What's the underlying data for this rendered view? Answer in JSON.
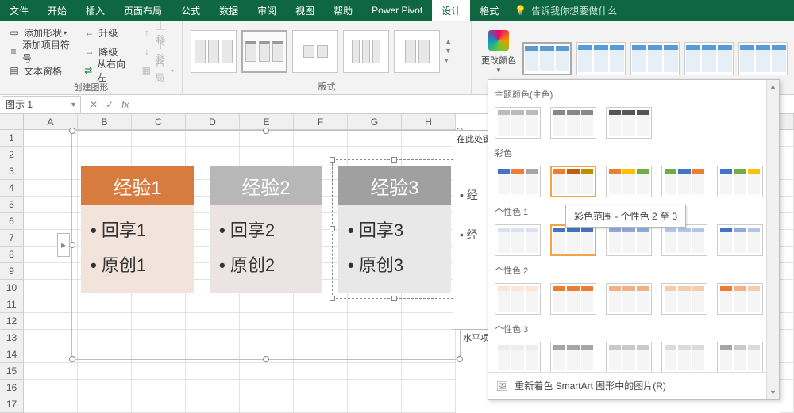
{
  "menu": {
    "items": [
      "文件",
      "开始",
      "插入",
      "页面布局",
      "公式",
      "数据",
      "审阅",
      "视图",
      "帮助",
      "Power Pivot",
      "设计",
      "格式"
    ],
    "active_index": 10,
    "tell_me": "告诉我你想要做什么"
  },
  "ribbon": {
    "group_create": {
      "label": "创建图形",
      "add_shape": "添加形状",
      "add_bullet": "添加项目符号",
      "text_pane": "文本窗格",
      "promote": "升级",
      "demote": "降级",
      "rtl": "从右向左",
      "move_up": "上移",
      "move_down": "下移",
      "layout_btn": "布局"
    },
    "group_layout": {
      "label": "版式"
    },
    "change_colors": "更改颜色"
  },
  "name_box": {
    "value": "图示 1"
  },
  "columns": [
    "A",
    "B",
    "C",
    "D",
    "E",
    "F",
    "G",
    "H"
  ],
  "rows": [
    1,
    2,
    3,
    4,
    5,
    6,
    7,
    8,
    9,
    10,
    11,
    12,
    13,
    14,
    15,
    16,
    17
  ],
  "smartart": {
    "cards": [
      {
        "title": "经验1",
        "items": [
          "回享1",
          "原创1"
        ]
      },
      {
        "title": "经验2",
        "items": [
          "回享2",
          "原创2"
        ]
      },
      {
        "title": "经验3",
        "items": [
          "回享3",
          "原创3"
        ]
      }
    ]
  },
  "text_pane": {
    "title": "在此处键入",
    "items": [
      "经",
      "经"
    ],
    "footer": "水平项目"
  },
  "color_dropdown": {
    "sections": {
      "theme": "主题颜色(主色)",
      "colorful": "彩色",
      "accent1": "个性色 1",
      "accent2": "个性色 2",
      "accent3": "个性色 3"
    },
    "tooltip": "彩色范围 - 个性色 2 至 3",
    "footer": "重新着色 SmartArt 图形中的图片(R)"
  },
  "style_accents": [
    "#5a9bd5",
    "#5a9bd5",
    "#5a9bd5",
    "#5a9bd5",
    "#5a9bd5"
  ],
  "colorful_row": [
    [
      "#4472c4",
      "#ed7d31",
      "#a5a5a5"
    ],
    [
      "#ed7d31",
      "#c55a11",
      "#bf8f00"
    ],
    [
      "#ed7d31",
      "#ffc000",
      "#70ad47"
    ],
    [
      "#70ad47",
      "#4472c4",
      "#ed7d31"
    ],
    [
      "#4472c4",
      "#70ad47",
      "#ffc000"
    ]
  ],
  "accent1_row": [
    [
      "#d9e1f2",
      "#d9e1f2",
      "#d9e1f2"
    ],
    [
      "#4472c4",
      "#4472c4",
      "#4472c4"
    ],
    [
      "#8ea9db",
      "#8ea9db",
      "#8ea9db"
    ],
    [
      "#b4c6e7",
      "#b4c6e7",
      "#b4c6e7"
    ],
    [
      "#4472c4",
      "#8ea9db",
      "#b4c6e7"
    ]
  ],
  "accent2_row": [
    [
      "#fce4d6",
      "#fce4d6",
      "#fce4d6"
    ],
    [
      "#ed7d31",
      "#ed7d31",
      "#ed7d31"
    ],
    [
      "#f4b084",
      "#f4b084",
      "#f4b084"
    ],
    [
      "#f8cbad",
      "#f8cbad",
      "#f8cbad"
    ],
    [
      "#ed7d31",
      "#f4b084",
      "#f8cbad"
    ]
  ],
  "accent3_row": [
    [
      "#ededed",
      "#ededed",
      "#ededed"
    ],
    [
      "#a5a5a5",
      "#a5a5a5",
      "#a5a5a5"
    ],
    [
      "#c9c9c9",
      "#c9c9c9",
      "#c9c9c9"
    ],
    [
      "#dbdbdb",
      "#dbdbdb",
      "#dbdbdb"
    ],
    [
      "#a5a5a5",
      "#c9c9c9",
      "#dbdbdb"
    ]
  ]
}
